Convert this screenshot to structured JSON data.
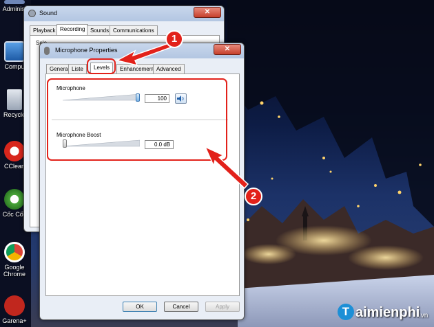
{
  "desktop": {
    "icons": [
      {
        "label": "Administ",
        "icon": "computer-icon"
      },
      {
        "label": "Compu",
        "icon": "computer-icon"
      },
      {
        "label": "Recycle",
        "icon": "recycle-bin-icon"
      },
      {
        "label": "CClean",
        "icon": "ccleaner-icon"
      },
      {
        "label": "Cốc Cốc",
        "icon": "coccoc-browser-icon"
      },
      {
        "label": "Google Chrome",
        "icon": "chrome-icon"
      },
      {
        "label": "Garena+",
        "icon": "garena-icon"
      }
    ]
  },
  "sound_window": {
    "title": "Sound",
    "close_glyph": "✕",
    "tabs": [
      "Playback",
      "Recording",
      "Sounds",
      "Communications"
    ],
    "active_tab": "Recording",
    "body_text": "Sele"
  },
  "mic_window": {
    "title": "Microphone Properties",
    "close_glyph": "✕",
    "tabs": [
      "General",
      "Liste",
      "Levels",
      "Enhancements",
      "Advanced"
    ],
    "active_tab": "Levels",
    "microphone": {
      "label": "Microphone",
      "value": "100",
      "level": 1.0,
      "speaker_icon": "speaker-icon"
    },
    "boost": {
      "label": "Microphone Boost",
      "value": "0.0 dB",
      "level": 0.0
    },
    "buttons": {
      "ok": "OK",
      "cancel": "Cancel",
      "apply": "Apply"
    }
  },
  "annotations": {
    "marker1": "1",
    "marker2": "2",
    "accent_color": "#e2211a"
  },
  "watermark": {
    "text": "aimienphi",
    "suffix": ".vn"
  }
}
